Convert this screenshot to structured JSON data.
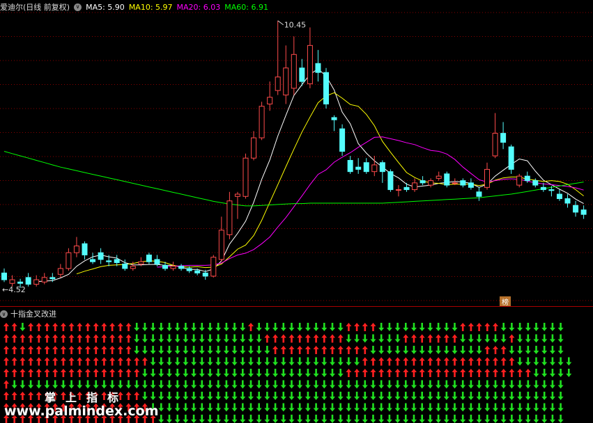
{
  "header": {
    "title": "爱迪尔(日线 前复权)",
    "ma_labels": [
      {
        "key": "ma5",
        "text": "MA5: 5.90",
        "color": "#ffffff"
      },
      {
        "key": "ma10",
        "text": "MA10: 5.97",
        "color": "#ffff00"
      },
      {
        "key": "ma20",
        "text": "MA20: 6.03",
        "color": "#ff00ff"
      },
      {
        "key": "ma60",
        "text": "MA60: 6.91",
        "color": "#00ff00"
      }
    ]
  },
  "colors": {
    "up": "#ff4b4b",
    "down": "#54fcfc",
    "ma5": "#ffffff",
    "ma10": "#ffff00",
    "ma20": "#ff00ff",
    "ma60": "#00ff00",
    "arrow_up": "#ff2020",
    "arrow_down": "#20e020",
    "grid": "#8b0000"
  },
  "annotations": {
    "high_label": "10.45",
    "low_label": "4.52"
  },
  "badge": "榜",
  "indicator": {
    "name": "十指金叉改进"
  },
  "watermark": {
    "line1": "掌上指标",
    "line2": "www.palmindex.com"
  },
  "chart_data": {
    "type": "candlestick",
    "title": "爱迪尔(日线 前复权)",
    "price_range": [
      4.3,
      10.6
    ],
    "candles": [
      [
        4.85,
        4.7,
        4.95,
        4.65
      ],
      [
        4.62,
        4.7,
        4.8,
        4.55
      ],
      [
        4.65,
        4.62,
        4.72,
        4.52
      ],
      [
        4.75,
        4.6,
        4.85,
        4.55
      ],
      [
        4.6,
        4.7,
        4.8,
        4.55
      ],
      [
        4.65,
        4.75,
        4.85,
        4.6
      ],
      [
        4.75,
        4.72,
        4.85,
        4.65
      ],
      [
        4.82,
        4.95,
        5.05,
        4.75
      ],
      [
        4.95,
        5.3,
        5.4,
        4.9
      ],
      [
        5.3,
        5.45,
        5.65,
        5.2
      ],
      [
        5.5,
        5.25,
        5.55,
        5.15
      ],
      [
        5.15,
        5.1,
        5.3,
        5.05
      ],
      [
        5.3,
        5.15,
        5.4,
        5.05
      ],
      [
        5.12,
        5.1,
        5.25,
        5.0
      ],
      [
        5.15,
        5.08,
        5.25,
        5.0
      ],
      [
        5.05,
        4.95,
        5.15,
        4.9
      ],
      [
        4.95,
        5.0,
        5.1,
        4.9
      ],
      [
        5.05,
        5.1,
        5.2,
        5.0
      ],
      [
        5.25,
        5.1,
        5.3,
        5.05
      ],
      [
        5.15,
        5.05,
        5.25,
        5.0
      ],
      [
        5.02,
        4.95,
        5.1,
        4.9
      ],
      [
        4.95,
        5.0,
        5.1,
        4.9
      ],
      [
        5.0,
        4.95,
        5.05,
        4.9
      ],
      [
        4.95,
        4.9,
        5.0,
        4.85
      ],
      [
        4.9,
        4.85,
        4.95,
        4.8
      ],
      [
        4.85,
        4.78,
        4.92,
        4.7
      ],
      [
        4.78,
        5.2,
        5.25,
        4.75
      ],
      [
        5.15,
        5.8,
        6.1,
        5.1
      ],
      [
        5.7,
        6.45,
        6.65,
        5.6
      ],
      [
        6.55,
        6.6,
        6.65,
        6.05
      ],
      [
        6.55,
        7.4,
        7.5,
        6.5
      ],
      [
        7.4,
        7.85,
        8.0,
        7.35
      ],
      [
        7.85,
        8.55,
        8.65,
        7.8
      ],
      [
        8.6,
        8.75,
        9.1,
        8.45
      ],
      [
        8.9,
        9.2,
        10.45,
        8.8
      ],
      [
        8.8,
        9.4,
        9.9,
        8.6
      ],
      [
        8.95,
        9.7,
        10.1,
        8.8
      ],
      [
        9.4,
        9.1,
        9.6,
        9.0
      ],
      [
        9.05,
        9.9,
        10.3,
        8.95
      ],
      [
        9.5,
        9.3,
        9.8,
        9.1
      ],
      [
        9.3,
        8.6,
        9.4,
        8.5
      ],
      [
        8.3,
        8.25,
        8.35,
        8.0
      ],
      [
        8.05,
        7.55,
        8.15,
        7.45
      ],
      [
        7.35,
        7.1,
        7.45,
        7.05
      ],
      [
        7.2,
        7.15,
        7.4,
        7.05
      ],
      [
        7.3,
        7.1,
        7.4,
        7.05
      ],
      [
        7.1,
        7.25,
        7.45,
        7.0
      ],
      [
        7.3,
        7.1,
        7.35,
        6.85
      ],
      [
        7.1,
        6.7,
        7.15,
        6.65
      ],
      [
        6.7,
        6.7,
        6.8,
        6.55
      ],
      [
        6.75,
        6.7,
        6.85,
        6.65
      ],
      [
        6.7,
        6.85,
        6.95,
        6.65
      ],
      [
        6.9,
        6.85,
        7.0,
        6.8
      ],
      [
        6.8,
        6.9,
        6.95,
        6.75
      ],
      [
        6.95,
        7.0,
        7.1,
        6.9
      ],
      [
        7.05,
        6.8,
        7.1,
        6.75
      ],
      [
        6.85,
        6.85,
        6.95,
        6.8
      ],
      [
        6.9,
        6.8,
        6.95,
        6.75
      ],
      [
        6.85,
        6.75,
        6.95,
        6.7
      ],
      [
        6.65,
        6.55,
        6.75,
        6.45
      ],
      [
        6.75,
        7.15,
        7.3,
        6.7
      ],
      [
        7.45,
        7.95,
        8.4,
        7.4
      ],
      [
        7.95,
        7.75,
        8.2,
        7.6
      ],
      [
        7.65,
        7.15,
        7.7,
        7.05
      ],
      [
        6.8,
        7.0,
        7.05,
        6.75
      ],
      [
        7.0,
        6.9,
        7.1,
        6.85
      ],
      [
        6.9,
        6.8,
        6.95,
        6.75
      ],
      [
        6.75,
        6.7,
        6.85,
        6.65
      ],
      [
        6.7,
        6.68,
        6.78,
        6.55
      ],
      [
        6.6,
        6.5,
        6.7,
        6.45
      ],
      [
        6.5,
        6.4,
        6.6,
        6.3
      ],
      [
        6.35,
        6.2,
        6.45,
        6.1
      ],
      [
        6.25,
        6.15,
        6.35,
        6.05
      ]
    ],
    "series": [
      {
        "name": "MA5",
        "values": [
          null,
          null,
          null,
          null,
          4.66,
          4.67,
          4.68,
          4.74,
          4.82,
          5.0,
          5.12,
          5.21,
          5.25,
          5.21,
          5.18,
          5.08,
          5.03,
          5.03,
          5.04,
          5.04,
          5.02,
          5.02,
          4.98,
          4.93,
          4.93,
          4.88,
          4.94,
          5.12,
          5.49,
          5.73,
          6.0,
          6.42,
          6.93,
          7.36,
          7.89,
          8.35,
          8.79,
          9.03,
          9.26,
          9.38,
          9.22,
          8.91,
          8.42,
          8.16,
          7.72,
          7.51,
          7.34,
          7.2,
          7.06,
          6.96,
          6.82,
          6.76,
          6.78,
          6.8,
          6.84,
          6.86,
          6.88,
          6.87,
          6.84,
          6.75,
          6.82,
          7.0,
          7.13,
          7.26,
          7.38,
          7.34,
          7.11,
          6.91,
          6.81,
          6.71,
          6.62,
          6.49,
          6.39
        ]
      },
      {
        "name": "MA10",
        "values": [
          null,
          null,
          null,
          null,
          null,
          null,
          null,
          null,
          null,
          4.83,
          4.89,
          4.94,
          4.99,
          5.02,
          5.03,
          5.04,
          5.06,
          5.1,
          5.12,
          5.11,
          5.08,
          5.02,
          4.99,
          4.98,
          4.99,
          4.97,
          4.98,
          5.05,
          5.21,
          5.38,
          5.47,
          5.68,
          6.02,
          6.42,
          6.81,
          7.21,
          7.6,
          7.98,
          8.31,
          8.63,
          8.78,
          8.85,
          8.73,
          8.59,
          8.55,
          8.37,
          8.12,
          7.77,
          7.53,
          7.3,
          7.08,
          6.97,
          6.89,
          6.85,
          6.84,
          6.81,
          6.82,
          6.82,
          6.82,
          6.79,
          6.82,
          6.91,
          6.96,
          6.98,
          6.98,
          6.93,
          6.91,
          6.88,
          6.9,
          6.88,
          6.82,
          6.7,
          6.56
        ]
      },
      {
        "name": "MA20",
        "values": [
          null,
          null,
          null,
          null,
          null,
          null,
          null,
          null,
          null,
          null,
          null,
          null,
          null,
          null,
          null,
          null,
          null,
          null,
          null,
          4.98,
          4.99,
          5.0,
          5.01,
          5.02,
          5.02,
          5.02,
          5.03,
          5.07,
          5.17,
          5.25,
          5.29,
          5.37,
          5.5,
          5.65,
          5.87,
          6.08,
          6.32,
          6.56,
          6.81,
          7.04,
          7.14,
          7.31,
          7.42,
          7.52,
          7.64,
          7.75,
          7.86,
          7.87,
          7.83,
          7.79,
          7.74,
          7.7,
          7.63,
          7.57,
          7.55,
          7.49,
          7.37,
          7.2,
          7.06,
          6.92,
          6.87,
          6.9,
          6.93,
          6.94,
          6.93,
          6.89,
          6.85,
          6.83,
          6.81,
          6.79,
          6.77,
          6.74,
          6.69
        ]
      },
      {
        "name": "MA60",
        "values": [
          7.55,
          7.5,
          7.45,
          7.4,
          7.35,
          7.3,
          7.25,
          7.2,
          7.16,
          7.12,
          7.08,
          7.04,
          7.0,
          6.96,
          6.92,
          6.88,
          6.84,
          6.8,
          6.76,
          6.72,
          6.68,
          6.64,
          6.6,
          6.56,
          6.52,
          6.48,
          6.44,
          6.41,
          6.38,
          6.36,
          6.34,
          6.34,
          6.35,
          6.36,
          6.37,
          6.38,
          6.39,
          6.39,
          6.4,
          6.4,
          6.4,
          6.4,
          6.4,
          6.4,
          6.4,
          6.4,
          6.4,
          6.4,
          6.41,
          6.42,
          6.43,
          6.44,
          6.45,
          6.46,
          6.47,
          6.48,
          6.49,
          6.5,
          6.51,
          6.52,
          6.54,
          6.56,
          6.58,
          6.6,
          6.63,
          6.66,
          6.69,
          6.72,
          6.75,
          6.78,
          6.81,
          6.84,
          6.87
        ]
      }
    ],
    "indicator_rows": [
      "UUDUUUUUUUUUUUUUDDDDDDDDDDDDDDUDDDDDDDDDDDUUUUDDDDDDDDDDUUUUUDDDDDDDD",
      "UUUUUUUUUUUUUUUUDDDDDDDDDDDDDDDDUUUUUUUUUUDDDDDDDUUUUUUUDDDDDDUDDDDDD",
      "UUUUUUUUUUUUUUUUDDDDDDDDDDDDDDDDDUUUUUUUUUUUUDDDDDDDDDDDDDDUUUDDDDDDD",
      "UUUUUUUUUUUUUUUUUUDDDDDDDDDDDDDDDDDDDDDDDDDDUUUUUUUUUUUUUUUUUUUDDDDDDD",
      "UUUUUUUUUUUUUUUUUDDDDDDDDDDDDDDDDDDDDDDDDDUUUUUUUUUUUUUUUUUUUUUUUDDDDD",
      "UDDDDDDDDDDDDDDDDDDDDDDDDDDDDDDDDDDDDDDDDDDDDDDDDDDDDDDDDDDDDDDDDDDDD",
      "UUUUUUUUUUUUUUUUUDDDDDDDDDDDDDDDDDDDDDDDDDDDDDDDDDDDDDDDDDDDDDDDDDDDD",
      "UUUUUUUUUUUUUUUUUUDDDDDDDDDDDDDDDDDDDDDDDDDDDDDDDDDDDDDDDDDDDDDDDDDDD",
      "UUUUUUUUUUUUUUUUUUUDDDDDDDDDDDDDDDDDDDDDDDDDDDDDDDDDDDDDDDDDDDDDDDDDD"
    ]
  }
}
